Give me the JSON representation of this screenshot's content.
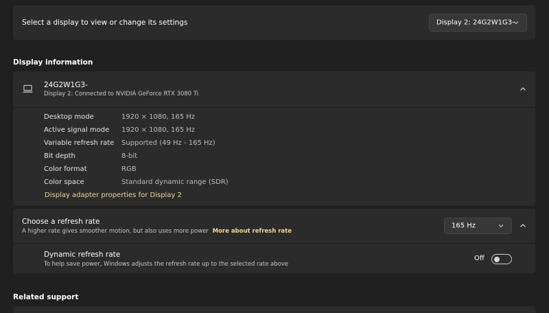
{
  "select_display": {
    "label": "Select a display to view or change its settings",
    "dropdown_value": "Display 2: 24G2W1G3-"
  },
  "display_info": {
    "section_title": "Display information",
    "monitor_name": "24G2W1G3-",
    "monitor_subtitle": "Display 2: Connected to NVIDIA GeForce RTX 3080 Ti",
    "details": [
      {
        "label": "Desktop mode",
        "value": "1920 × 1080, 165 Hz"
      },
      {
        "label": "Active signal mode",
        "value": "1920 × 1080, 165 Hz"
      },
      {
        "label": "Variable refresh rate",
        "value": "Supported (49 Hz - 165 Hz)"
      },
      {
        "label": "Bit depth",
        "value": "8-bit"
      },
      {
        "label": "Color format",
        "value": "RGB"
      },
      {
        "label": "Color space",
        "value": "Standard dynamic range (SDR)"
      }
    ],
    "adapter_link": "Display adapter properties for Display 2"
  },
  "refresh": {
    "title": "Choose a refresh rate",
    "description": "A higher rate gives smoother motion, but also uses more power",
    "more_link": "More about refresh rate",
    "dropdown_value": "165 Hz",
    "dynamic_title": "Dynamic refresh rate",
    "dynamic_description": "To help save power, Windows adjusts the refresh rate up to the selected rate above",
    "toggle_state": "Off"
  },
  "related": {
    "section_title": "Related support"
  },
  "colors": {
    "background": "#202020",
    "card": "#2b2b2b",
    "accent_link": "#f0d494"
  },
  "icons": {
    "monitor": "monitor-icon",
    "chevron_down": "chevron-down-icon",
    "chevron_up": "chevron-up-icon"
  }
}
